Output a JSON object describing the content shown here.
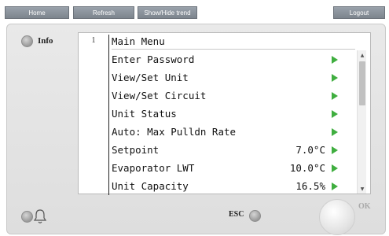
{
  "toolbar": {
    "home_label": "Home",
    "refresh_label": "Refresh",
    "trend_label": "Show/Hide trend",
    "logout_label": "Logout"
  },
  "panel": {
    "info_label": "Info",
    "esc_label": "ESC",
    "ok_label": "OK"
  },
  "screen": {
    "page_number": "1",
    "title": "Main Menu",
    "items": [
      {
        "label": "Enter Password",
        "value": ""
      },
      {
        "label": "View/Set Unit",
        "value": ""
      },
      {
        "label": "View/Set Circuit",
        "value": ""
      },
      {
        "label": "Unit Status",
        "value": ""
      },
      {
        "label": "Auto: Max Pulldn Rate",
        "value": ""
      },
      {
        "label": "Setpoint",
        "value": "7.0°C"
      },
      {
        "label": "Evaporator LWT",
        "value": "10.0°C"
      },
      {
        "label": "Unit Capacity",
        "value": "16.5%"
      }
    ]
  },
  "colors": {
    "toolbar_button": "#8a929b",
    "arrow_green": "#3fae3f",
    "panel_bg": "#e4e4e4"
  },
  "icons": {
    "row_arrow": "play-arrow-icon",
    "alarm": "bell-icon"
  }
}
